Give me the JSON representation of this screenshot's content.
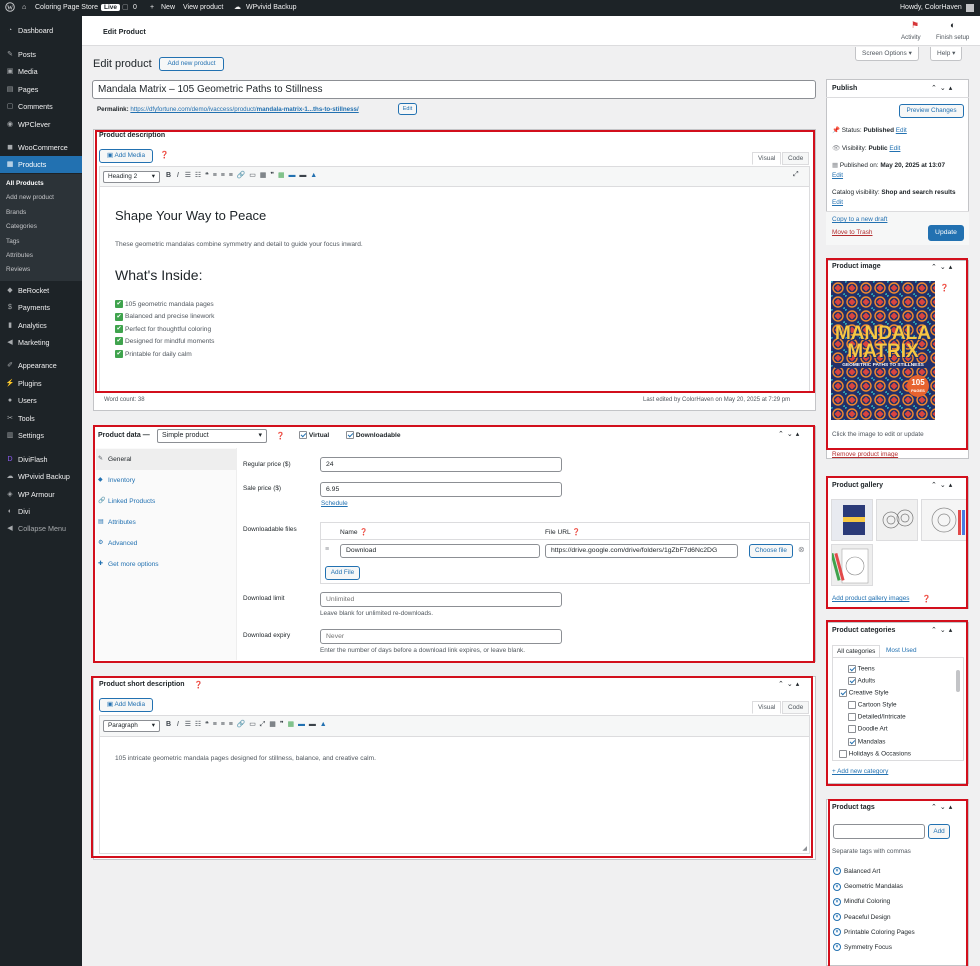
{
  "adminbar": {
    "wp_logo": "wordpress-icon",
    "site_name": "Coloring Page Store",
    "live": "Live",
    "comments_count": "0",
    "new_label": "New",
    "view_product": "View product",
    "backup": "WPvivid Backup",
    "howdy": "Howdy, ColorHaven"
  },
  "sidebar": {
    "items": [
      {
        "label": "Dashboard",
        "icon": "dashboard-icon"
      },
      {
        "label": "Posts",
        "icon": "pin-icon"
      },
      {
        "label": "Media",
        "icon": "media-icon"
      },
      {
        "label": "Pages",
        "icon": "page-icon"
      },
      {
        "label": "Comments",
        "icon": "comment-icon"
      },
      {
        "label": "WPClever",
        "icon": "plugin-icon"
      },
      {
        "label": "WooCommerce",
        "icon": "woo-icon"
      },
      {
        "label": "Products",
        "icon": "products-icon"
      },
      {
        "label": "BeRocket",
        "icon": "plugin-icon"
      },
      {
        "label": "Payments",
        "icon": "payments-icon"
      },
      {
        "label": "Analytics",
        "icon": "chart-icon"
      },
      {
        "label": "Marketing",
        "icon": "megaphone-icon"
      },
      {
        "label": "Appearance",
        "icon": "brush-icon"
      },
      {
        "label": "Plugins",
        "icon": "plug-icon"
      },
      {
        "label": "Users",
        "icon": "user-icon"
      },
      {
        "label": "Tools",
        "icon": "wrench-icon"
      },
      {
        "label": "Settings",
        "icon": "settings-icon"
      },
      {
        "label": "DiviFlash",
        "icon": "plugin-icon"
      },
      {
        "label": "WPvivid Backup",
        "icon": "backup-icon"
      },
      {
        "label": "WP Armour",
        "icon": "shield-icon"
      },
      {
        "label": "Divi",
        "icon": "divi-icon"
      },
      {
        "label": "Collapse Menu",
        "icon": "collapse-icon"
      }
    ],
    "submenu": [
      "All Products",
      "Add new product",
      "Brands",
      "Categories",
      "Tags",
      "Attributes",
      "Reviews"
    ]
  },
  "topbar": {
    "title": "Edit Product",
    "activity": "Activity",
    "finish_setup": "Finish setup"
  },
  "screen_options": "Screen Options ▾",
  "help": "Help ▾",
  "page": {
    "heading": "Edit product",
    "add_new": "Add new product",
    "product_title": "Mandala Matrix – 105 Geometric Paths to Stillness",
    "permalink_label": "Permalink:",
    "permalink_base": "https://dfyfortune.com/demo/ivaccess/product/",
    "permalink_slug": "mandala-matrix-1...ths-to-stillness/",
    "permalink_edit": "Edit"
  },
  "description": {
    "title": "Product description",
    "add_media": "Add Media",
    "tab_visual": "Visual",
    "tab_code": "Code",
    "format": "Heading 2",
    "heading1": "Shape Your Way to Peace",
    "intro": "These geometric mandalas combine symmetry and detail to guide your focus inward.",
    "heading2": "What's Inside:",
    "bullets": [
      "105 geometric mandala pages",
      "Balanced and precise linework",
      "Perfect for thoughtful coloring",
      "Designed for mindful moments",
      "Printable for daily calm"
    ],
    "word_count": "Word count: 38",
    "last_edited": "Last edited by ColorHaven on May 20, 2025 at 7:29 pm"
  },
  "product_data": {
    "title": "Product data —",
    "type": "Simple product",
    "virtual": "Virtual",
    "downloadable": "Downloadable",
    "tabs": [
      {
        "label": "General",
        "icon": "wrench-icon"
      },
      {
        "label": "Inventory",
        "icon": "diamond-icon"
      },
      {
        "label": "Linked Products",
        "icon": "link-icon"
      },
      {
        "label": "Attributes",
        "icon": "list-icon"
      },
      {
        "label": "Advanced",
        "icon": "gear-icon"
      },
      {
        "label": "Get more options",
        "icon": "plugin-icon"
      }
    ],
    "regular_price_label": "Regular price ($)",
    "regular_price": "24",
    "sale_price_label": "Sale price ($)",
    "sale_price": "6.95",
    "schedule": "Schedule",
    "downloadable_files_label": "Downloadable files",
    "col_name": "Name",
    "col_url": "File URL",
    "file_name": "Download",
    "file_url": "https://drive.google.com/drive/folders/1gZbF7d6Nc2DG",
    "choose_file": "Choose file",
    "add_file": "Add File",
    "download_limit_label": "Download limit",
    "download_limit_placeholder": "Unlimited",
    "download_limit_hint": "Leave blank for unlimited re-downloads.",
    "download_expiry_label": "Download expiry",
    "download_expiry_placeholder": "Never",
    "download_expiry_hint": "Enter the number of days before a download link expires, or leave blank."
  },
  "short_description": {
    "title": "Product short description",
    "add_media": "Add Media",
    "tab_visual": "Visual",
    "tab_code": "Code",
    "format": "Paragraph",
    "text": "105 intricate geometric mandala pages designed for stillness, balance, and creative calm."
  },
  "publish": {
    "title": "Publish",
    "preview": "Preview Changes",
    "status_label": "Status:",
    "status": "Published",
    "visibility_label": "Visibility:",
    "visibility": "Public",
    "published_on": "Published on:",
    "published_date": "May 20, 2025 at 13:07",
    "catalog_label": "Catalog visibility:",
    "catalog": "Shop and search results",
    "edit": "Edit",
    "copy_draft": "Copy to a new draft",
    "trash": "Move to Trash",
    "update": "Update"
  },
  "product_image": {
    "title": "Product image",
    "cover_line1": "MANDALA",
    "cover_line2": "MATRIX",
    "cover_subtitle": "GEOMETRIC PATHS TO STILLNESS",
    "cover_badge_num": "105",
    "cover_badge_txt": "PAGES",
    "hint": "Click the image to edit or update",
    "remove": "Remove product image"
  },
  "gallery": {
    "title": "Product gallery",
    "add": "Add product gallery images"
  },
  "categories": {
    "title": "Product categories",
    "tab_all": "All categories",
    "tab_most": "Most Used",
    "items": [
      {
        "label": "Teens",
        "checked": true,
        "indent": 1
      },
      {
        "label": "Adults",
        "checked": true,
        "indent": 1
      },
      {
        "label": "Creative Style",
        "checked": true,
        "indent": 0
      },
      {
        "label": "Cartoon Style",
        "checked": false,
        "indent": 1
      },
      {
        "label": "Detailed/Intricate",
        "checked": false,
        "indent": 1
      },
      {
        "label": "Doodle Art",
        "checked": false,
        "indent": 1
      },
      {
        "label": "Mandalas",
        "checked": true,
        "indent": 1
      },
      {
        "label": "Holidays & Occasions",
        "checked": false,
        "indent": 0
      }
    ],
    "add_new": "+ Add new category"
  },
  "tags": {
    "title": "Product tags",
    "add": "Add",
    "hint": "Separate tags with commas",
    "items": [
      "Balanced Art",
      "Geometric Mandalas",
      "Mindful Coloring",
      "Peaceful Design",
      "Printable Coloring Pages",
      "Symmetry Focus"
    ]
  },
  "colors": {
    "admin_dark": "#1d2327",
    "accent": "#2271b1",
    "highlight": "#d20f1c"
  }
}
